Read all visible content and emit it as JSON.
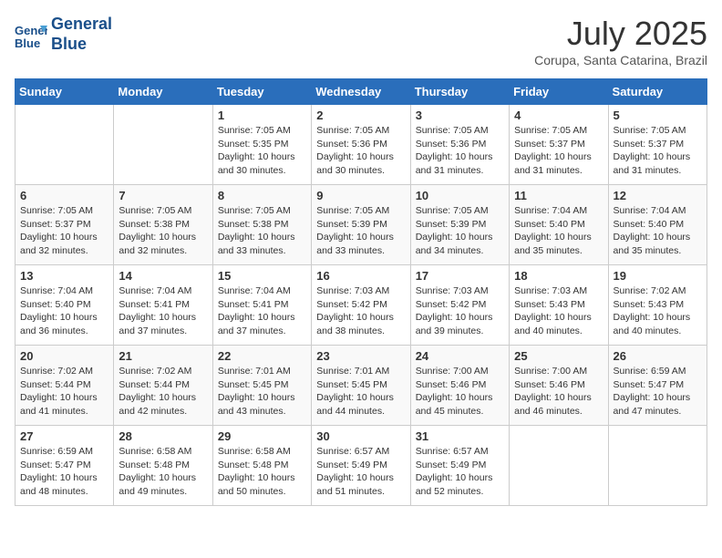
{
  "header": {
    "logo_line1": "General",
    "logo_line2": "Blue",
    "month": "July 2025",
    "location": "Corupa, Santa Catarina, Brazil"
  },
  "weekdays": [
    "Sunday",
    "Monday",
    "Tuesday",
    "Wednesday",
    "Thursday",
    "Friday",
    "Saturday"
  ],
  "weeks": [
    [
      {
        "day": "",
        "info": ""
      },
      {
        "day": "",
        "info": ""
      },
      {
        "day": "1",
        "info": "Sunrise: 7:05 AM\nSunset: 5:35 PM\nDaylight: 10 hours and 30 minutes."
      },
      {
        "day": "2",
        "info": "Sunrise: 7:05 AM\nSunset: 5:36 PM\nDaylight: 10 hours and 30 minutes."
      },
      {
        "day": "3",
        "info": "Sunrise: 7:05 AM\nSunset: 5:36 PM\nDaylight: 10 hours and 31 minutes."
      },
      {
        "day": "4",
        "info": "Sunrise: 7:05 AM\nSunset: 5:37 PM\nDaylight: 10 hours and 31 minutes."
      },
      {
        "day": "5",
        "info": "Sunrise: 7:05 AM\nSunset: 5:37 PM\nDaylight: 10 hours and 31 minutes."
      }
    ],
    [
      {
        "day": "6",
        "info": "Sunrise: 7:05 AM\nSunset: 5:37 PM\nDaylight: 10 hours and 32 minutes."
      },
      {
        "day": "7",
        "info": "Sunrise: 7:05 AM\nSunset: 5:38 PM\nDaylight: 10 hours and 32 minutes."
      },
      {
        "day": "8",
        "info": "Sunrise: 7:05 AM\nSunset: 5:38 PM\nDaylight: 10 hours and 33 minutes."
      },
      {
        "day": "9",
        "info": "Sunrise: 7:05 AM\nSunset: 5:39 PM\nDaylight: 10 hours and 33 minutes."
      },
      {
        "day": "10",
        "info": "Sunrise: 7:05 AM\nSunset: 5:39 PM\nDaylight: 10 hours and 34 minutes."
      },
      {
        "day": "11",
        "info": "Sunrise: 7:04 AM\nSunset: 5:40 PM\nDaylight: 10 hours and 35 minutes."
      },
      {
        "day": "12",
        "info": "Sunrise: 7:04 AM\nSunset: 5:40 PM\nDaylight: 10 hours and 35 minutes."
      }
    ],
    [
      {
        "day": "13",
        "info": "Sunrise: 7:04 AM\nSunset: 5:40 PM\nDaylight: 10 hours and 36 minutes."
      },
      {
        "day": "14",
        "info": "Sunrise: 7:04 AM\nSunset: 5:41 PM\nDaylight: 10 hours and 37 minutes."
      },
      {
        "day": "15",
        "info": "Sunrise: 7:04 AM\nSunset: 5:41 PM\nDaylight: 10 hours and 37 minutes."
      },
      {
        "day": "16",
        "info": "Sunrise: 7:03 AM\nSunset: 5:42 PM\nDaylight: 10 hours and 38 minutes."
      },
      {
        "day": "17",
        "info": "Sunrise: 7:03 AM\nSunset: 5:42 PM\nDaylight: 10 hours and 39 minutes."
      },
      {
        "day": "18",
        "info": "Sunrise: 7:03 AM\nSunset: 5:43 PM\nDaylight: 10 hours and 40 minutes."
      },
      {
        "day": "19",
        "info": "Sunrise: 7:02 AM\nSunset: 5:43 PM\nDaylight: 10 hours and 40 minutes."
      }
    ],
    [
      {
        "day": "20",
        "info": "Sunrise: 7:02 AM\nSunset: 5:44 PM\nDaylight: 10 hours and 41 minutes."
      },
      {
        "day": "21",
        "info": "Sunrise: 7:02 AM\nSunset: 5:44 PM\nDaylight: 10 hours and 42 minutes."
      },
      {
        "day": "22",
        "info": "Sunrise: 7:01 AM\nSunset: 5:45 PM\nDaylight: 10 hours and 43 minutes."
      },
      {
        "day": "23",
        "info": "Sunrise: 7:01 AM\nSunset: 5:45 PM\nDaylight: 10 hours and 44 minutes."
      },
      {
        "day": "24",
        "info": "Sunrise: 7:00 AM\nSunset: 5:46 PM\nDaylight: 10 hours and 45 minutes."
      },
      {
        "day": "25",
        "info": "Sunrise: 7:00 AM\nSunset: 5:46 PM\nDaylight: 10 hours and 46 minutes."
      },
      {
        "day": "26",
        "info": "Sunrise: 6:59 AM\nSunset: 5:47 PM\nDaylight: 10 hours and 47 minutes."
      }
    ],
    [
      {
        "day": "27",
        "info": "Sunrise: 6:59 AM\nSunset: 5:47 PM\nDaylight: 10 hours and 48 minutes."
      },
      {
        "day": "28",
        "info": "Sunrise: 6:58 AM\nSunset: 5:48 PM\nDaylight: 10 hours and 49 minutes."
      },
      {
        "day": "29",
        "info": "Sunrise: 6:58 AM\nSunset: 5:48 PM\nDaylight: 10 hours and 50 minutes."
      },
      {
        "day": "30",
        "info": "Sunrise: 6:57 AM\nSunset: 5:49 PM\nDaylight: 10 hours and 51 minutes."
      },
      {
        "day": "31",
        "info": "Sunrise: 6:57 AM\nSunset: 5:49 PM\nDaylight: 10 hours and 52 minutes."
      },
      {
        "day": "",
        "info": ""
      },
      {
        "day": "",
        "info": ""
      }
    ]
  ]
}
